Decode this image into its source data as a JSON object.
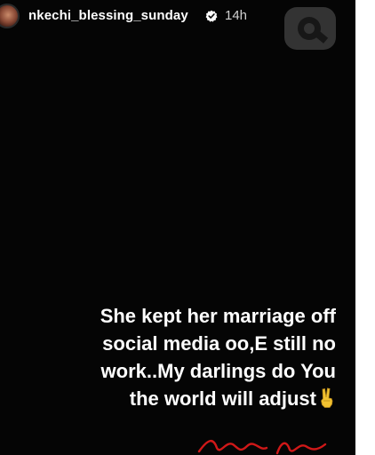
{
  "story": {
    "username": "nkechi_blessing_sunday",
    "timestamp": "14h",
    "verified": true,
    "background_color": "#050505",
    "text_color": "#ffffff",
    "caption_lines": [
      "She kept her marriage off",
      "social media oo,E still no",
      "work..My darlings do You",
      "the world will adjust"
    ],
    "caption_emoji": "victory-hand-icon"
  },
  "icons": {
    "avatar": "avatar",
    "verified": "verified-badge-icon",
    "watermark": "watermark-logo-icon",
    "signature": "red-handwritten-signature"
  },
  "colors": {
    "verified_badge": "#ffffff",
    "signature": "#d01818",
    "emoji": "#f2c230"
  }
}
